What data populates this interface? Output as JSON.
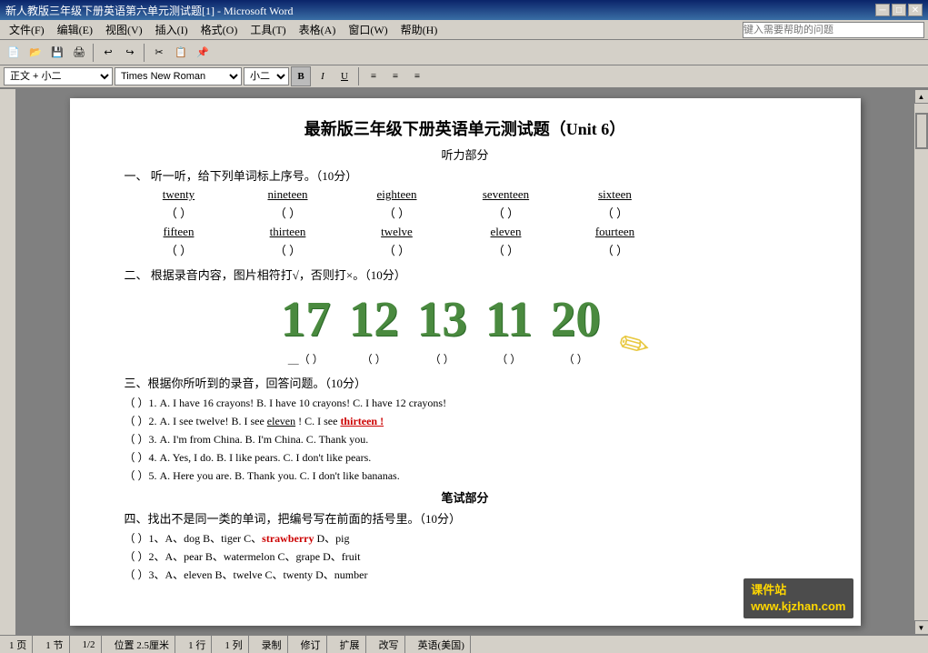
{
  "titlebar": {
    "title": "新人教版三年级下册英语第六单元测试题[1] - Microsoft Word",
    "min_label": "─",
    "max_label": "□",
    "close_label": "✕"
  },
  "menubar": {
    "items": [
      "文件(F)",
      "编辑(E)",
      "视图(V)",
      "插入(I)",
      "格式(O)",
      "工具(T)",
      "表格(A)",
      "窗口(W)",
      "帮助(H)"
    ]
  },
  "toolbar": {
    "help_placeholder": "键入需要帮助的问题",
    "style_value": "正文 + 小二",
    "font_value": "Times New Roman",
    "size_value": "小二"
  },
  "document": {
    "title": "最新版三年级下册英语单元测试题（Unit 6）",
    "section1_title": "听力部分",
    "q1_header": "一、   听一听，给下列单词标上序号。（10分）",
    "q1_words_row1": [
      "twenty",
      "nineteen",
      "eighteen",
      "seventeen",
      "sixteen"
    ],
    "q1_blanks_row1": [
      "（     ）",
      "（     ）",
      "（     ）",
      "（     ）",
      "（     ）"
    ],
    "q1_words_row2": [
      "fifteen",
      "thirteen",
      "twelve",
      "eleven",
      "fourteen"
    ],
    "q1_blanks_row2": [
      "（     ）",
      "（     ）",
      "（     ）",
      "（     ）",
      "（     ）"
    ],
    "q2_header": "二、   根据录音内容，图片相符打√，否则打×。（10分）",
    "q2_numbers": [
      "17",
      "12",
      "13",
      "11",
      "20"
    ],
    "q2_blanks": [
      "＿（    ）",
      "（    ）",
      "（    ）",
      "（    ）",
      "（    ）"
    ],
    "q3_header": "三、根据你所听到的录音，回答问题。（10分）",
    "q3_items": [
      "（  ）1. A. I have 16 crayons!   B. I have 10 crayons!   C. I have 12 crayons!",
      "（  ）2. A. I see twelve!    B. I see eleven !    C. I see thirteen !",
      "（  ）3. A. I'm from China.    B. I'm China.    C. Thank you.",
      "（  ）4. A. Yes, I do.    B. I like pears.   C. I don't like pears.",
      "（  ）5. A. Here you are.    B. Thank you.  C. I don't like bananas."
    ],
    "writing_section": "笔试部分",
    "q4_header": "四、找出不是同一类的单词，把编号写在前面的括号里。（10分）",
    "q4_items": [
      "（    ）1、A、dog     B、tiger          C、strawberry    D、pig",
      "（    ）2、A、pear     B、watermelon   C、grape          D、fruit",
      "（    ）3、A、eleven   B、twelve         C、twenty          D、number"
    ]
  },
  "statusbar": {
    "page": "1 页",
    "section": "1 节",
    "pages": "1/2",
    "position": "位置 2.5厘米",
    "line": "1 行",
    "col": "1 列",
    "record": "录制",
    "modify": "修订",
    "extend": "扩展",
    "overwrite": "改写",
    "lang": "英语(美国)"
  },
  "watermark": {
    "line1": "课件站",
    "line2": "www.kjzhan.com"
  }
}
